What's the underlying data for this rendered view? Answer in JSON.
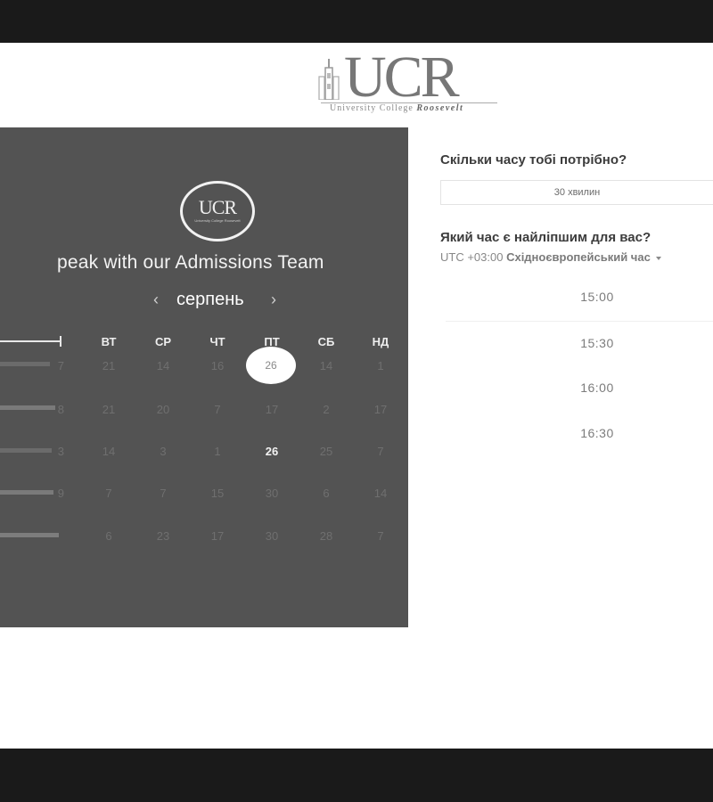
{
  "logo": {
    "letters": "UCR",
    "subtitle": "University College",
    "subtitle_brand": "Roosevelt"
  },
  "panel": {
    "badge_letters": "UCR",
    "badge_sub": "University College Roosevelt",
    "title": "peak with our Admissions Team",
    "month": "серпень",
    "prev_icon": "chevron-left-icon",
    "next_icon": "chevron-right-icon"
  },
  "calendar": {
    "weekdays": [
      "ВТ",
      "СР",
      "ЧТ",
      "ПТ",
      "СБ",
      "НД"
    ],
    "rows": [
      {
        "lead": "7",
        "days": [
          "21",
          "14",
          "16",
          "26",
          "14",
          "1"
        ]
      },
      {
        "lead": "8",
        "days": [
          "21",
          "20",
          "7",
          "17",
          "2",
          "17"
        ]
      },
      {
        "lead": "3",
        "days": [
          "14",
          "3",
          "1",
          "26",
          "25",
          "7"
        ]
      },
      {
        "lead": "9",
        "days": [
          "7",
          "7",
          "15",
          "30",
          "6",
          "14"
        ]
      },
      {
        "lead": "",
        "days": [
          "6",
          "23",
          "17",
          "30",
          "28",
          "7"
        ]
      }
    ],
    "selected": "26"
  },
  "booking": {
    "duration_question": "Скільки часу тобі потрібно?",
    "duration_value": "30 хвилин",
    "time_question": "Який час є найліпшим для вас?",
    "tz_offset": "UTC +03:00",
    "tz_name": "Східноєвропейський час",
    "tz_icon": "caret-down-icon",
    "slots": [
      "15:00",
      "15:30",
      "16:00",
      "16:30"
    ]
  },
  "colors": {
    "panel_bg": "#535353",
    "bar_bg": "#1a1a1a",
    "page_bg": "#ffffff"
  }
}
